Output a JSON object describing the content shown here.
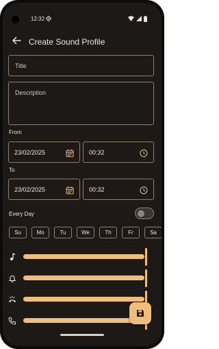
{
  "status_bar": {
    "time": "12:32"
  },
  "app_bar": {
    "title": "Create Sound Profile"
  },
  "form": {
    "title_placeholder": "Title",
    "description_placeholder": "Description",
    "from_label": "From",
    "from_date": "23/02/2025",
    "from_time": "00:32",
    "to_label": "To",
    "to_date": "23/02/2025",
    "to_time": "00:32",
    "every_day_label": "Every Day",
    "every_day_enabled": false
  },
  "days": [
    "Su",
    "Mo",
    "Tu",
    "We",
    "Th",
    "Fr",
    "Sa"
  ],
  "volume_sliders": [
    {
      "icon": "music-note-icon",
      "level": 1.0
    },
    {
      "icon": "bell-icon",
      "level": 1.0
    },
    {
      "icon": "ringtone-icon",
      "level": 1.0
    },
    {
      "icon": "phone-icon",
      "level": 1.0
    }
  ],
  "colors": {
    "background": "#1c1917",
    "accent": "#f2bd7a",
    "outline": "#8a7f72"
  }
}
